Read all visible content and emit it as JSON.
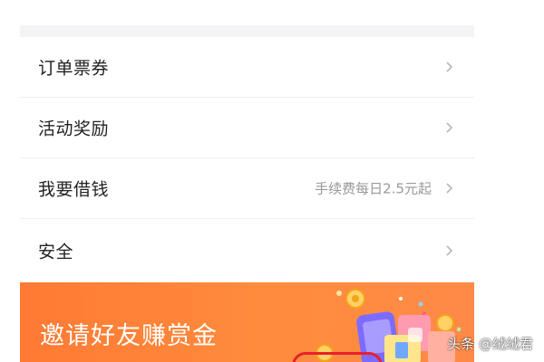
{
  "menu": {
    "items": [
      {
        "label": "订单票券",
        "sub": ""
      },
      {
        "label": "活动奖励",
        "sub": ""
      },
      {
        "label": "我要借钱",
        "sub": "手续费每日2.5元起"
      },
      {
        "label": "安全",
        "sub": ""
      }
    ]
  },
  "banner": {
    "title": "邀请好友赚赏金",
    "color": "#ff7a34"
  },
  "watermark": {
    "text": "头条 @绒绒君"
  },
  "icons": {
    "chevron": "chevron-right-icon"
  }
}
